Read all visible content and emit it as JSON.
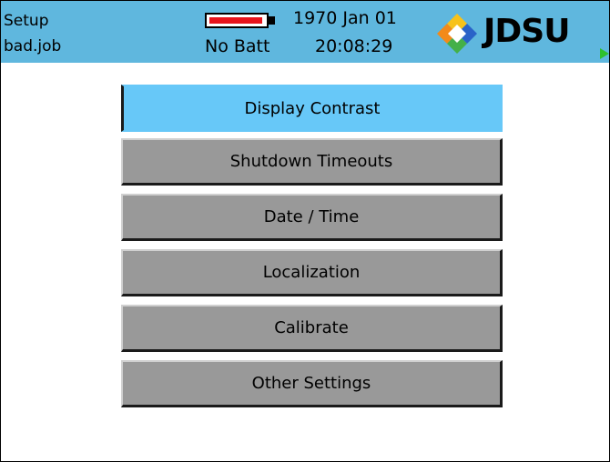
{
  "header": {
    "app_name": "Setup",
    "job_name": "bad.job",
    "battery_status": "No Batt",
    "date": "1970 Jan 01",
    "time": "20:08:29",
    "logo_text": "JDSU",
    "battery_fill_color": "#e8141c"
  },
  "menu": {
    "selected_index": 0,
    "items": [
      {
        "label": "Display Contrast"
      },
      {
        "label": "Shutdown Timeouts"
      },
      {
        "label": "Date / Time"
      },
      {
        "label": "Localization"
      },
      {
        "label": "Calibrate"
      },
      {
        "label": "Other Settings"
      }
    ]
  },
  "colors": {
    "header_bg": "#5fb7de",
    "selected_bg": "#67c8f8",
    "button_bg": "#999999"
  },
  "icons": {
    "battery": "battery-icon",
    "logo": "jdsu-logo-icon",
    "softkey_arrow": "play-arrow-icon"
  }
}
